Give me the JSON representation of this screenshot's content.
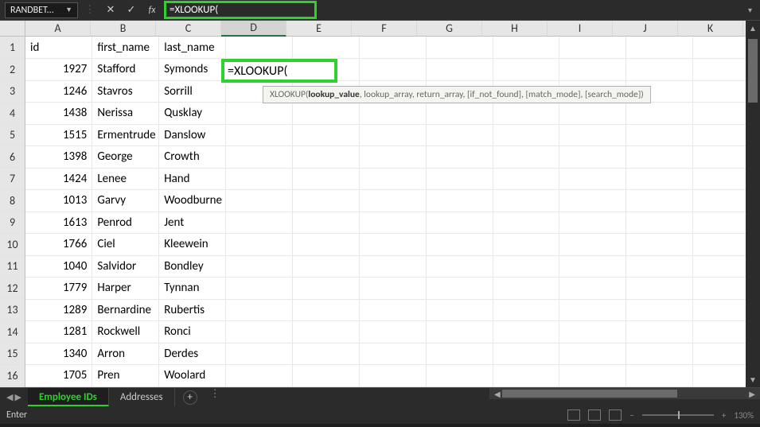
{
  "formula_bar": {
    "name_box": "RANDBET...",
    "dots_btn": "⋮",
    "cancel_btn": "✕",
    "accept_btn": "✓",
    "fx_label": "fx",
    "formula": "=XLOOKUP(",
    "collapse": "▾"
  },
  "active_cell": {
    "text": "=XLOOKUP("
  },
  "tooltip": {
    "fn": "XLOOKUP(",
    "arg_bold": "lookup_value",
    "rest": ", lookup_array, return_array, [if_not_found], [match_mode], [search_mode])"
  },
  "columns": [
    "A",
    "B",
    "C",
    "D",
    "E",
    "F",
    "G",
    "H",
    "I",
    "J",
    "K"
  ],
  "row_headers": [
    "1",
    "2",
    "3",
    "4",
    "5",
    "6",
    "7",
    "8",
    "9",
    "10",
    "11",
    "12",
    "13",
    "14",
    "15",
    "16"
  ],
  "headers": {
    "A": "id",
    "B": "first_name",
    "C": "last_name"
  },
  "rows": [
    {
      "id": "1927",
      "first": "Stafford",
      "last": "Symonds"
    },
    {
      "id": "1246",
      "first": "Stavros",
      "last": "Sorrill"
    },
    {
      "id": "1438",
      "first": "Nerissa",
      "last": "Qusklay"
    },
    {
      "id": "1515",
      "first": "Ermentrude",
      "last": "Danslow"
    },
    {
      "id": "1398",
      "first": "George",
      "last": "Crowth"
    },
    {
      "id": "1424",
      "first": "Lenee",
      "last": "Hand"
    },
    {
      "id": "1013",
      "first": "Garvy",
      "last": "Woodburne"
    },
    {
      "id": "1613",
      "first": "Penrod",
      "last": "Jent"
    },
    {
      "id": "1766",
      "first": "Ciel",
      "last": "Kleewein"
    },
    {
      "id": "1040",
      "first": "Salvidor",
      "last": "Bondley"
    },
    {
      "id": "1779",
      "first": "Harper",
      "last": "Tynnan"
    },
    {
      "id": "1289",
      "first": "Bernardine",
      "last": "Rubertis"
    },
    {
      "id": "1281",
      "first": "Rockwell",
      "last": "Ronci"
    },
    {
      "id": "1340",
      "first": "Arron",
      "last": "Derdes"
    },
    {
      "id": "1705",
      "first": "Pren",
      "last": "Woolard"
    }
  ],
  "sheets": {
    "active": "Employee IDs",
    "other": "Addresses",
    "add": "+"
  },
  "status": {
    "mode": "Enter",
    "zoom": "130%",
    "minus": "−",
    "plus": "+"
  }
}
